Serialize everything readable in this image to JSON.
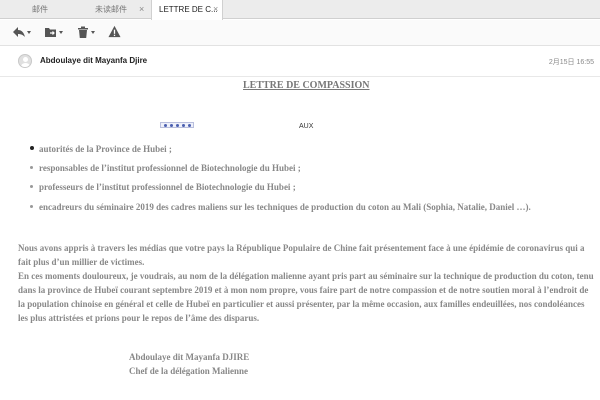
{
  "tabs": [
    {
      "label": "邮件",
      "active": false
    },
    {
      "label": "未读邮件",
      "active": false,
      "close": "×"
    },
    {
      "label": "LETTRE DE C...",
      "active": true,
      "close": "×"
    }
  ],
  "toolbar": {
    "icons": [
      "reply-icon",
      "move-folder-icon",
      "trash-icon",
      "warning-icon"
    ]
  },
  "message": {
    "sender": "Abdoulaye dit Mayanfa Djire",
    "date": "2月15日 16:55"
  },
  "letter": {
    "title": "LETTRE DE COMPASSION",
    "aux": "AUX",
    "recipients": [
      "autorités de la Province de Hubei ;",
      "responsables de l’institut professionnel de Biotechnologie du Hubei ;",
      "professeurs de l’institut professionnel de Biotechnologie du Hubei ;",
      "encadreurs du séminaire 2019 des cadres maliens sur les techniques de production du coton au Mali (Sophia, Natalie, Daniel …)."
    ],
    "paragraph1": "Nous avons appris à travers les médias que votre pays la République Populaire de Chine fait présentement face à une épidémie de coronavirus qui a fait plus d’un millier de victimes.",
    "paragraph2": "En ces moments douloureux, je voudrais, au nom de la délégation malienne ayant pris part au séminaire sur la technique de production du coton, tenu dans la province de Hubeï courant septembre 2019 et à mon nom propre, vous faire part de notre compassion et de notre soutien moral à l’endroit de la population chinoise en général et celle de Hubeï en particulier et aussi présenter, par la même occasion,  aux familles endeuillées, nos condoléances les plus attristées et prions pour le repos de l’âme des disparus.",
    "signature_name": "Abdoulaye dit Mayanfa DJIRE",
    "signature_title": "Chef de la délégation Malienne"
  },
  "colors": {
    "accent": "#4b5fb0",
    "body_text": "#888888"
  }
}
